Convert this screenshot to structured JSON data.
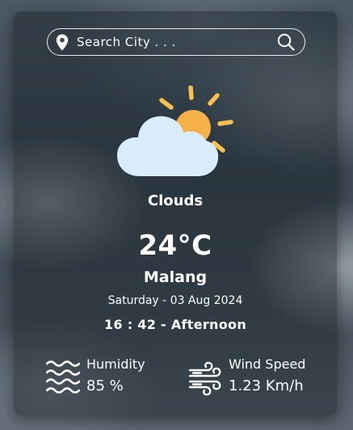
{
  "search": {
    "placeholder": "Search City . . .",
    "location_icon": "map-pin-icon",
    "search_icon": "magnifier-icon"
  },
  "weather": {
    "icon": "partly-cloudy-icon",
    "condition": "Clouds",
    "temperature": "24°C",
    "city": "Malang",
    "date": "Saturday - 03 Aug 2024",
    "time": "16 : 42 - Afternoon"
  },
  "stats": {
    "humidity": {
      "icon": "waves-icon",
      "label": "Humidity",
      "value": "85 %"
    },
    "wind": {
      "icon": "wind-icon",
      "label": "Wind Speed",
      "value": "1.23 Km/h"
    }
  },
  "colors": {
    "sun": "#f5b04a",
    "sun_rays": "#f7c14f",
    "cloud": "#d9ecfb",
    "text": "#ffffff"
  }
}
